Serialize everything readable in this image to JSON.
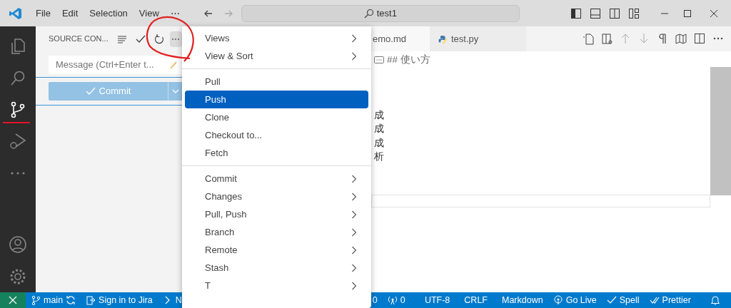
{
  "title_bar": {
    "menus": [
      "File",
      "Edit",
      "Selection",
      "View",
      "⋯"
    ],
    "command_center": "test1"
  },
  "activity_bar": [
    {
      "kind": "files",
      "selected": false
    },
    {
      "kind": "search",
      "selected": false
    },
    {
      "kind": "source-control",
      "selected": true
    },
    {
      "kind": "run",
      "selected": false
    },
    {
      "kind": "more",
      "selected": false
    },
    {
      "kind": "account",
      "selected": false
    },
    {
      "kind": "settings",
      "selected": false
    }
  ],
  "sidebar": {
    "title": "SOURCE CON...",
    "more_button": "⋯",
    "message_placeholder": "Message (Ctrl+Enter t...",
    "commit_button": "Commit"
  },
  "context_menu": [
    {
      "label": "Views",
      "submenu": true,
      "selected": false,
      "kind": "item"
    },
    {
      "label": "View & Sort",
      "submenu": true,
      "selected": false,
      "kind": "item"
    },
    {
      "kind": "separator"
    },
    {
      "label": "Pull",
      "submenu": false,
      "selected": false,
      "kind": "item"
    },
    {
      "label": "Push",
      "submenu": false,
      "selected": true,
      "kind": "item"
    },
    {
      "label": "Clone",
      "submenu": false,
      "selected": false,
      "kind": "item"
    },
    {
      "label": "Checkout to...",
      "submenu": false,
      "selected": false,
      "kind": "item"
    },
    {
      "label": "Fetch",
      "submenu": false,
      "selected": false,
      "kind": "item"
    },
    {
      "kind": "separator"
    },
    {
      "label": "Commit",
      "submenu": true,
      "selected": false,
      "kind": "item"
    },
    {
      "label": "Changes",
      "submenu": true,
      "selected": false,
      "kind": "item"
    },
    {
      "label": "Pull, Push",
      "submenu": true,
      "selected": false,
      "kind": "item"
    },
    {
      "label": "Branch",
      "submenu": true,
      "selected": false,
      "kind": "item"
    },
    {
      "label": "Remote",
      "submenu": true,
      "selected": false,
      "kind": "item"
    },
    {
      "label": "Stash",
      "submenu": true,
      "selected": false,
      "kind": "item"
    },
    {
      "label": "T",
      "submenu": true,
      "selected": false,
      "kind": "item"
    }
  ],
  "editor": {
    "tabs": [
      {
        "label": "emo.md",
        "kind": "markdown",
        "selected": true
      },
      {
        "label": "test.py",
        "kind": "python",
        "selected": false
      }
    ],
    "lines": [
      "## 使い方",
      "成",
      "成",
      "成",
      "析"
    ]
  },
  "status_bar": [
    {
      "kind": "remote"
    },
    {
      "kind": "branch",
      "text": "main"
    },
    {
      "kind": "jira",
      "text": "Sign in to Jira"
    },
    {
      "kind": "chevron",
      "text": "N"
    },
    {
      "kind": "gap"
    },
    {
      "kind": "plain",
      "text": "0"
    },
    {
      "kind": "ports",
      "text": "0"
    },
    {
      "kind": "plain",
      "text": "UTF-8"
    },
    {
      "kind": "plain",
      "text": "CRLF"
    },
    {
      "kind": "plain",
      "text": "Markdown"
    },
    {
      "kind": "golive",
      "text": "Go Live"
    },
    {
      "kind": "check",
      "text": "Spell"
    },
    {
      "kind": "doublecheck",
      "text": "Prettier"
    },
    {
      "kind": "bell"
    }
  ]
}
